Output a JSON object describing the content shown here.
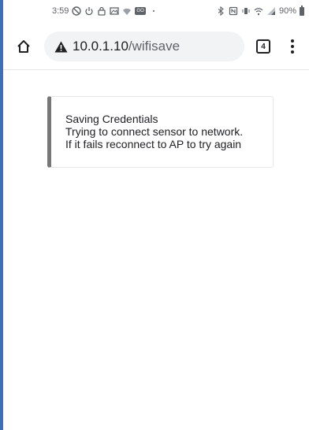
{
  "status_bar": {
    "time": "3:59",
    "battery_percent": "90%",
    "icons_left": [
      "do-not-disturb-icon",
      "power-icon",
      "lock-icon",
      "image-icon",
      "wifi-icon",
      "go-icon",
      "more-dots-icon"
    ],
    "icons_right": [
      "bluetooth-icon",
      "nfc-icon",
      "vibrate-icon",
      "wifi-signal-icon",
      "cell-signal-icon",
      "battery-icon"
    ],
    "go_badge": "GO"
  },
  "toolbar": {
    "url_host": "10.0.1.10",
    "url_path": "/wifisave",
    "tab_count": "4",
    "icons": [
      "home-icon",
      "not-secure-warning-icon",
      "tab-switcher-icon",
      "overflow-menu-icon"
    ]
  },
  "message": {
    "line1": "Saving Credentials",
    "line2": "Trying to connect sensor to network.",
    "line3": "If it fails reconnect to AP to try again"
  },
  "colors": {
    "accent_edge": "#3f6fb8",
    "card_border_left": "#777777",
    "omnibox_bg": "#f1f3f4"
  }
}
